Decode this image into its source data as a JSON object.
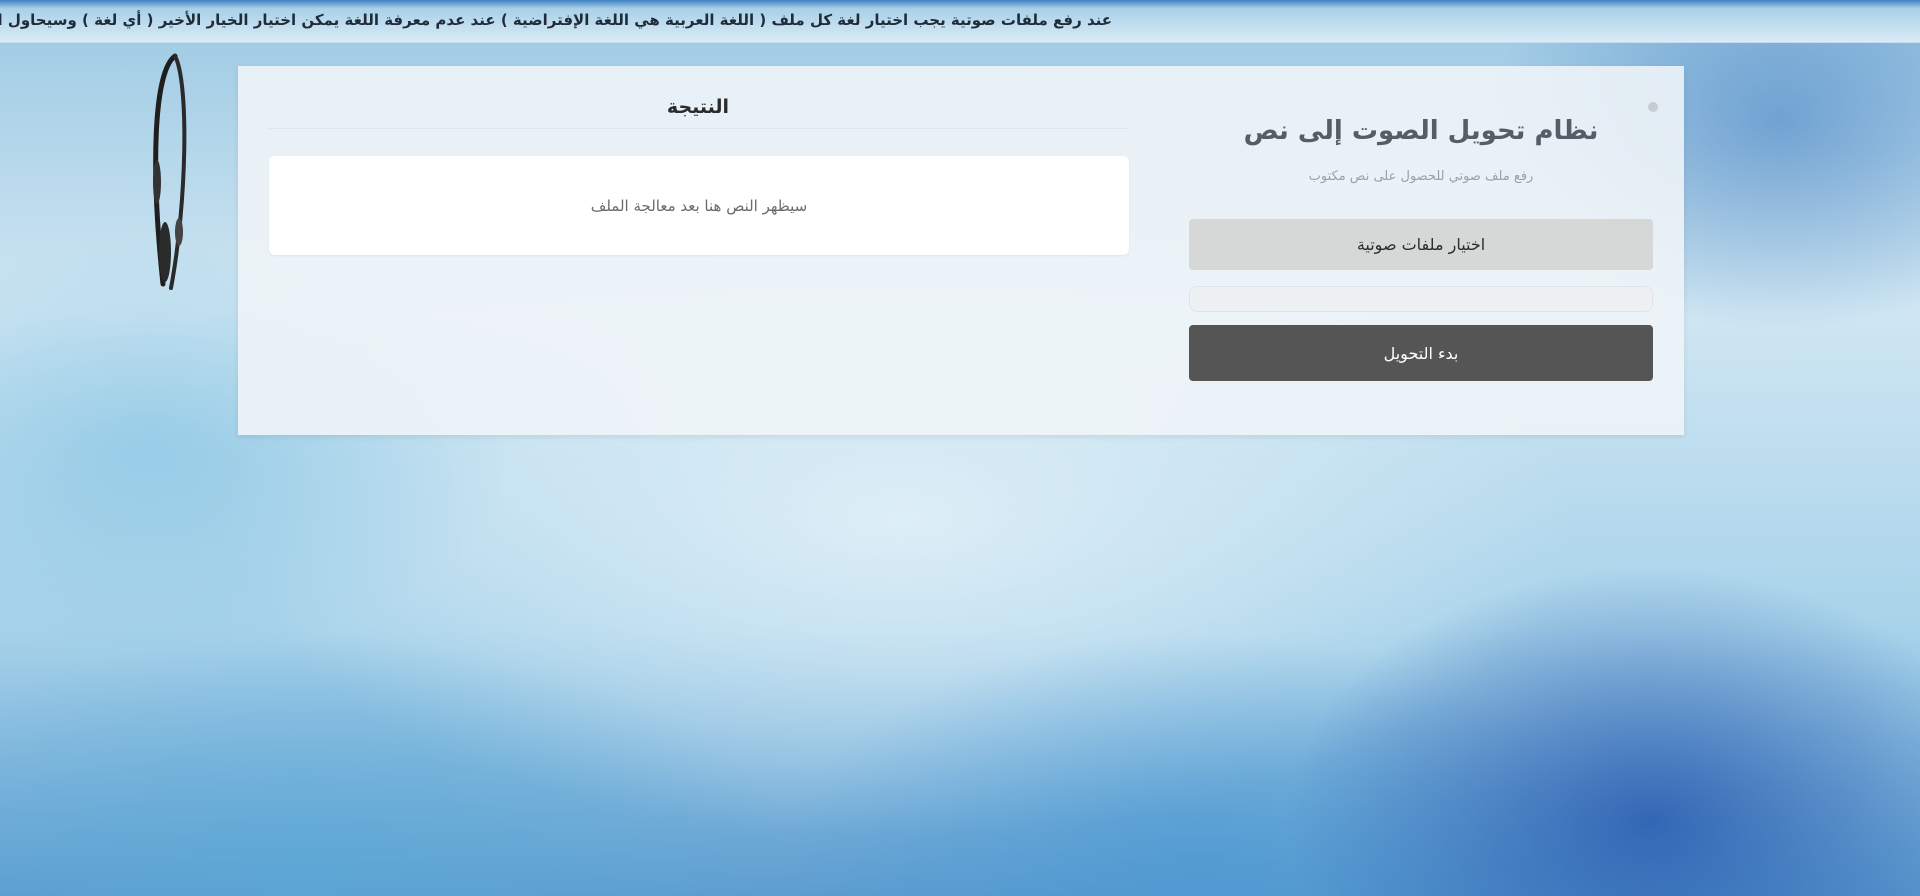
{
  "notice": {
    "text": "عند رفع ملفات صوتية يجب اختيار لغة كل ملف ( اللغة العربية هي اللغة الإفتراضية ) عند عدم معرفة اللغة يمكن اختيار الخيار الأخير ( أي لغة ) وسيحاول النظام ب"
  },
  "result": {
    "title": "النتيجة",
    "placeholder": "سيظهر النص هنا بعد معالجة الملف"
  },
  "converter": {
    "title": "نظام تحويل الصوت إلى نص",
    "subtitle": "رفع ملف صوتي للحصول على نص مكتوب",
    "choose_label": "اختيار ملفات صوتية",
    "progress": 0,
    "convert_label": "بدء التحويل"
  },
  "icons": {
    "decoration": "headphones-icon",
    "close": "close-icon"
  },
  "colors": {
    "convert_button": "#555555",
    "choose_button": "#d6d8d8"
  }
}
